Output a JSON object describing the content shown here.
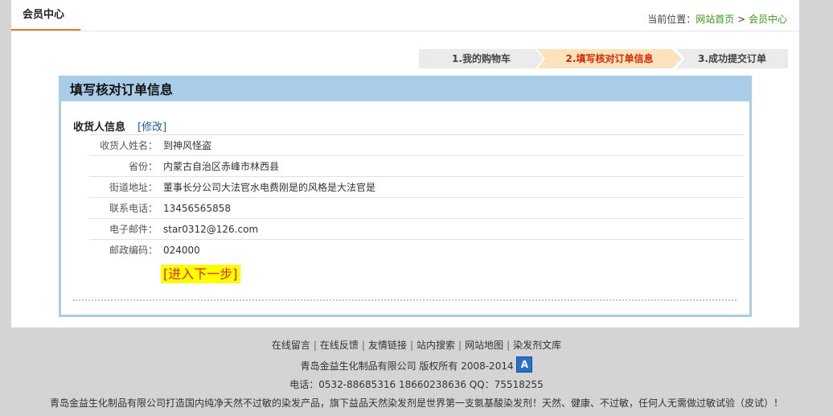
{
  "header": {
    "tab": "会员中心",
    "breadcrumb_label": "当前位置：",
    "breadcrumb_home": "网站首页",
    "breadcrumb_sep": ">",
    "breadcrumb_current": "会员中心"
  },
  "steps": [
    {
      "label": "1.我的购物车"
    },
    {
      "label": "2.填写核对订单信息"
    },
    {
      "label": "3.成功提交订单"
    }
  ],
  "panel": {
    "title": "填写核对订单信息",
    "section_title": "收货人信息",
    "edit_label": "[修改]",
    "rows": [
      {
        "label": "收货人姓名：",
        "value": "到神风怪盗"
      },
      {
        "label": "省份：",
        "value": "内蒙古自治区赤峰市林西县"
      },
      {
        "label": "街道地址：",
        "value": "董事长分公司大法官水电费刚是的风格是大法官是"
      },
      {
        "label": "联系电话：",
        "value": "13456565858"
      },
      {
        "label": "电子邮件：",
        "value": "star0312@126.com"
      },
      {
        "label": "邮政编码：",
        "value": "024000"
      }
    ],
    "next_button": "[进入下一步]"
  },
  "footer": {
    "links": [
      "在线留言",
      "在线反馈",
      "友情链接",
      "站内搜索",
      "网站地图",
      "染发剂文库"
    ],
    "link_separator": "|",
    "copyright": "青岛金益生化制品有限公司 版权所有 2008-2014",
    "badge_letter": "A",
    "contact": "电话：0532-88685316 18660238636 QQ：75518255",
    "slogan": "青岛金益生化制品有限公司打造国内纯净天然不过敏的染发产品，旗下益品天然染发剂是世界第一支氨基酸染发剂！天然、健康、不过敏，任何人无需做过敏试验（皮试）！"
  }
}
